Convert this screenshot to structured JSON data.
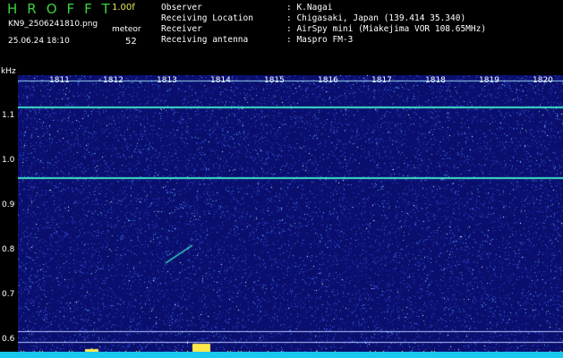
{
  "header": {
    "title": "HROFFT",
    "version": "1.00f",
    "filename": "KN9_2506241810.png",
    "meteor_label": "meteor",
    "datetime": "25.06.24 18:10",
    "meteor_count": "52"
  },
  "info": {
    "rows": [
      {
        "label": "Observer",
        "value": ": K.Nagai"
      },
      {
        "label": "Receiving Location",
        "value": ": Chigasaki, Japan (139.414 35.340)"
      },
      {
        "label": "Receiver",
        "value": ": AirSpy mini (Miakejima VOR 108.65MHz)"
      },
      {
        "label": "Receiving antenna",
        "value": ": Maspro FM-3"
      }
    ]
  },
  "spectrogram": {
    "y_unit": "kHz",
    "y_ticks": [
      "1.1",
      "1.0",
      "0.9",
      "0.8",
      "0.7",
      "0.6"
    ],
    "x_ticks": [
      "1811",
      "1812",
      "1813",
      "1814",
      "1815",
      "1816",
      "1817",
      "1818",
      "1819",
      "1820"
    ],
    "background_color": "#0a0f6e",
    "signal_color": "#3fe0c8",
    "bottom_band_color": "#19c8f0"
  }
}
